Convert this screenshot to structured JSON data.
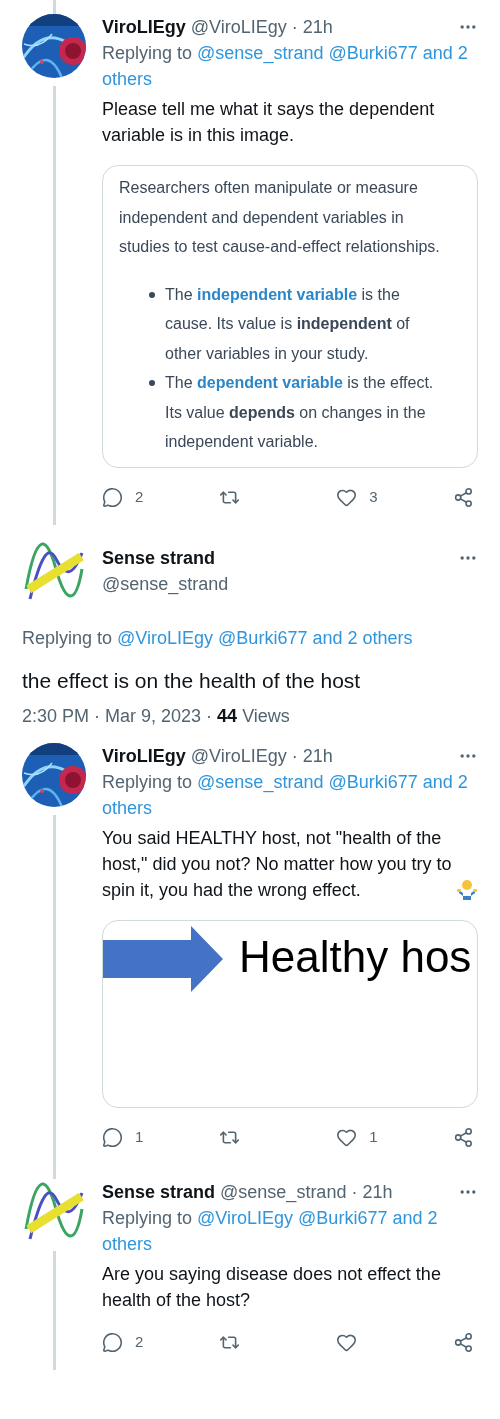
{
  "thread": [
    {
      "kind": "reply",
      "connector_above": true,
      "connector_below": true,
      "author": {
        "name": "ViroLIEgy",
        "meta": "@ViroLIEgy · 21h",
        "avatar": {
          "kind": "virus"
        }
      },
      "replying": {
        "label": "Replying to",
        "mentions": [
          "@sense_strand",
          "@Burki677",
          "and",
          "2",
          "others"
        ]
      },
      "text": "Please tell me what it says the dependent variable is in this image.",
      "card": {
        "kind": "article",
        "paragraph": "Researchers often manipulate or measure independent and dependent variables in studies to test cause-and-effect relationships.",
        "bullets": [
          [
            {
              "kind": "text",
              "text": "The"
            },
            {
              "kind": "link",
              "text": "independent variable"
            },
            {
              "kind": "text",
              "text": "is the cause. Its value is **independent** of other variables in your study."
            }
          ],
          [
            {
              "kind": "text",
              "text": "The"
            },
            {
              "kind": "link",
              "text": "dependent variable"
            },
            {
              "kind": "text",
              "text": "is the effect. Its value **depends** on changes in the independent variable."
            }
          ]
        ]
      },
      "actions": {
        "replies": "2",
        "likes": "3"
      }
    },
    {
      "kind": "focused",
      "author": {
        "name": "Sense strand",
        "meta": "@sense_strand",
        "avatar": {
          "kind": "waves"
        }
      },
      "replying": {
        "label": "Replying to",
        "mentions": [
          "@ViroLIEgy",
          "@Burki677",
          "and",
          "2",
          "others"
        ]
      },
      "text": "the effect is on the health of the host",
      "timestamp": "2:30 PM · Mar 9, 2023 ·",
      "views_count": "44",
      "views_label": "Views"
    },
    {
      "kind": "reply",
      "connector_above": false,
      "connector_below": true,
      "author": {
        "name": "ViroLIEgy",
        "meta": "@ViroLIEgy · 21h",
        "avatar": {
          "kind": "virus"
        }
      },
      "replying": {
        "label": "Replying to",
        "mentions": [
          "@sense_strand",
          "@Burki677",
          "and",
          "2",
          "others"
        ]
      },
      "text": "You said HEALTHY host, not \"health of the host,\" did you not? No matter how you try to spin it, you had the wrong effect.",
      "emoji": {
        "kind": "shrug"
      },
      "card": {
        "kind": "image",
        "caption": "Healthy hos"
      },
      "actions": {
        "replies": "1",
        "likes": "1"
      }
    },
    {
      "kind": "reply",
      "connector_above": true,
      "connector_below": true,
      "author": {
        "name": "Sense strand",
        "meta": "@sense_strand · 21h",
        "avatar": {
          "kind": "waves"
        }
      },
      "replying": {
        "label": "Replying to",
        "mentions": [
          "@ViroLIEgy",
          "@Burki677",
          "and",
          "2",
          "others"
        ]
      },
      "text": "Are you saying disease does not effect the health of the host?",
      "actions": {
        "replies": "2"
      }
    }
  ]
}
